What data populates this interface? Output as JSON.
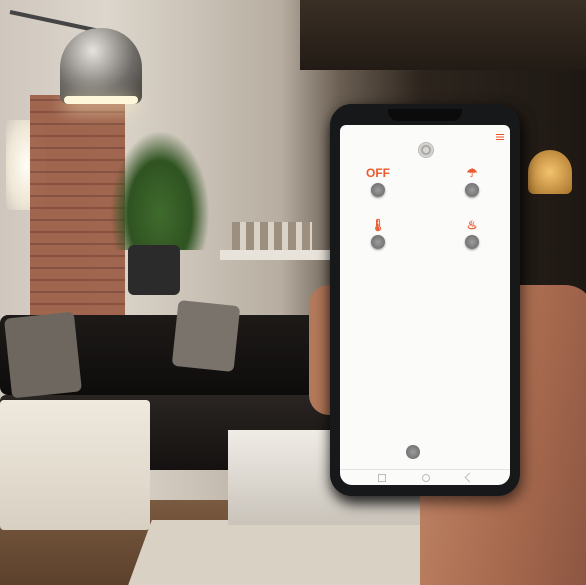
{
  "photo": {
    "subject": "smartphone-in-living-room"
  },
  "app": {
    "title": "",
    "menu_label": "",
    "accent_color": "#e8552b",
    "devices": [
      {
        "icon": "OFF",
        "label": "",
        "icon_name": "off-text-icon"
      },
      {
        "icon": "☂",
        "label": "",
        "icon_name": "lamp-icon"
      },
      {
        "icon": "🌡",
        "label": "",
        "icon_name": "thermometer-icon"
      },
      {
        "icon": "♨",
        "label": "",
        "icon_name": "heater-icon"
      }
    ],
    "bottom_label": ""
  }
}
